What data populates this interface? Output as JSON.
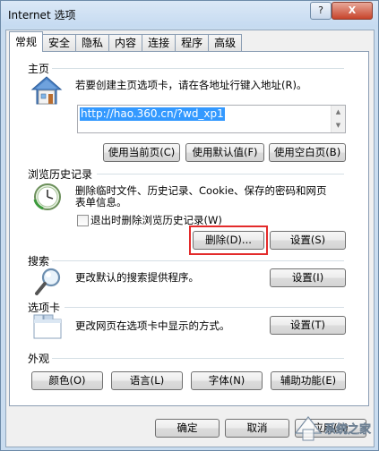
{
  "window": {
    "title": "Internet 选项",
    "help_label": "?",
    "close_label": "X"
  },
  "tabs": [
    "常规",
    "安全",
    "隐私",
    "内容",
    "连接",
    "程序",
    "高级"
  ],
  "home": {
    "section": "主页",
    "description": "若要创建主页选项卡，请在各地址行键入地址(R)。",
    "url": "http://hao.360.cn/?wd_xp1",
    "buttons": [
      "使用当前页(C)",
      "使用默认值(F)",
      "使用空白页(B)"
    ]
  },
  "history": {
    "section": "浏览历史记录",
    "description_line1": "删除临时文件、历史记录、Cookie、保存的密码和网页",
    "description_line2": "表单信息。",
    "checkbox_label": "退出时删除浏览历史记录(W)",
    "delete_label": "删除(D)...",
    "settings_label": "设置(S)"
  },
  "search": {
    "section": "搜索",
    "description": "更改默认的搜索提供程序。",
    "settings_label": "设置(I)"
  },
  "tabs_section": {
    "section": "选项卡",
    "description": "更改网页在选项卡中显示的方式。",
    "settings_label": "设置(T)"
  },
  "appearance": {
    "section": "外观",
    "buttons": [
      "颜色(O)",
      "语言(L)",
      "字体(N)",
      "辅助功能(E)"
    ]
  },
  "footer": {
    "ok_label": "确定",
    "cancel_label": "取消",
    "apply_label": "应用(A)"
  },
  "watermark": {
    "text": "系统之家"
  },
  "colors": {
    "accent_selection": "#3399ff",
    "highlight_box": "#e32b2b",
    "title_bar": "#c9dcef"
  }
}
